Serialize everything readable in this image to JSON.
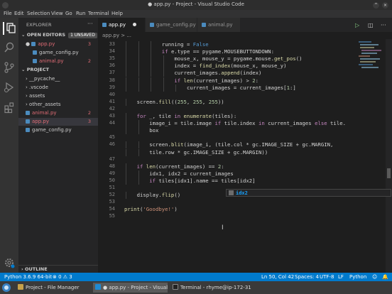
{
  "window": {
    "title": "● app.py - Project - Visual Studio Code"
  },
  "menu": [
    "File",
    "Edit",
    "Selection",
    "View",
    "Go",
    "Run",
    "Terminal",
    "Help"
  ],
  "sidebar": {
    "title": "EXPLORER",
    "open_editors": {
      "label": "OPEN EDITORS",
      "badge": "1 UNSAVED",
      "items": [
        {
          "name": "app.py",
          "count": "3",
          "modified": true
        },
        {
          "name": "game_config.py",
          "count": ""
        },
        {
          "name": "animal.py",
          "count": "2",
          "error": true
        }
      ]
    },
    "project": {
      "label": "PROJECT",
      "items": [
        {
          "name": "__pycache__",
          "type": "folder"
        },
        {
          "name": ".vscode",
          "type": "folder"
        },
        {
          "name": "assets",
          "type": "folder"
        },
        {
          "name": "other_assets",
          "type": "folder"
        },
        {
          "name": "animal.py",
          "count": "2",
          "error": true
        },
        {
          "name": "app.py",
          "count": "3",
          "selected": true
        },
        {
          "name": "game_config.py",
          "count": ""
        }
      ]
    },
    "outline": "OUTLINE"
  },
  "tabs": [
    {
      "label": "app.py",
      "active": true,
      "dirty": true
    },
    {
      "label": "game_config.py"
    },
    {
      "label": "animal.py"
    }
  ],
  "breadcrumb": "app.py > ...",
  "editor": {
    "lines": [
      {
        "n": "33",
        "indent": 3,
        "text": "running = False"
      },
      {
        "n": "34",
        "indent": 3,
        "text": "if e.type == pygame.MOUSEBUTTONDOWN:"
      },
      {
        "n": "35",
        "indent": 4,
        "text": "mouse_x, mouse_y = pygame.mouse.get_pos()"
      },
      {
        "n": "36",
        "indent": 4,
        "text": "index = find_index(mouse_x, mouse_y)"
      },
      {
        "n": "37",
        "indent": 4,
        "text": "current_images.append(index)"
      },
      {
        "n": "38",
        "indent": 4,
        "text": "if len(current_images) > 2:"
      },
      {
        "n": "39",
        "indent": 5,
        "text": "current_images = current_images[1:]"
      },
      {
        "n": "40",
        "indent": 0,
        "text": ""
      },
      {
        "n": "41",
        "indent": 1,
        "text": "screen.fill((255, 255, 255))"
      },
      {
        "n": "42",
        "indent": 0,
        "text": ""
      },
      {
        "n": "43",
        "indent": 1,
        "text": "for _, tile in enumerate(tiles):"
      },
      {
        "n": "44",
        "indent": 2,
        "text": "image_i = tile.image if tile.index in current_images else tile."
      },
      {
        "n": "",
        "indent": 2,
        "text": "box"
      },
      {
        "n": "45",
        "indent": 0,
        "text": ""
      },
      {
        "n": "46",
        "indent": 2,
        "text": "screen.blit(image_i, (tile.col * gc.IMAGE_SIZE + gc.MARGIN,"
      },
      {
        "n": "",
        "indent": 2,
        "text": "tile.row * gc.IMAGE_SIZE + gc.MARGIN))"
      },
      {
        "n": "47",
        "indent": 0,
        "text": ""
      },
      {
        "n": "48",
        "indent": 1,
        "text": "if len(current_images) == 2:"
      },
      {
        "n": "49",
        "indent": 2,
        "text": "idx1, idx2 = current_images"
      },
      {
        "n": "50",
        "indent": 2,
        "text": "if tiles[idx1].name == tiles[idx2]"
      },
      {
        "n": "51",
        "indent": 0,
        "text": ""
      },
      {
        "n": "52",
        "indent": 1,
        "text": "display.flip()"
      },
      {
        "n": "53",
        "indent": 0,
        "text": ""
      },
      {
        "n": "54",
        "indent": 0,
        "text": "print('Goodbye!')"
      },
      {
        "n": "55",
        "indent": 0,
        "text": ""
      }
    ],
    "suggestion": "idx2"
  },
  "statusbar": {
    "interpreter": "Python 3.6.9 64-bit",
    "problems": "⊗ 0 ⚠ 3",
    "position": "Ln 50, Col 42",
    "spaces": "Spaces: 4",
    "encoding": "UTF-8",
    "eol": "LF",
    "language": "Python"
  },
  "taskbar": {
    "items": [
      {
        "label": "Project - File Manager"
      },
      {
        "label": "● app.py - Project - Visual St...",
        "active": true
      },
      {
        "label": "Terminal - rhyme@ip-172-31-..."
      }
    ]
  },
  "colors": {
    "accent": "#007acc",
    "background": "#1e1e1e",
    "sidebar": "#252526"
  }
}
